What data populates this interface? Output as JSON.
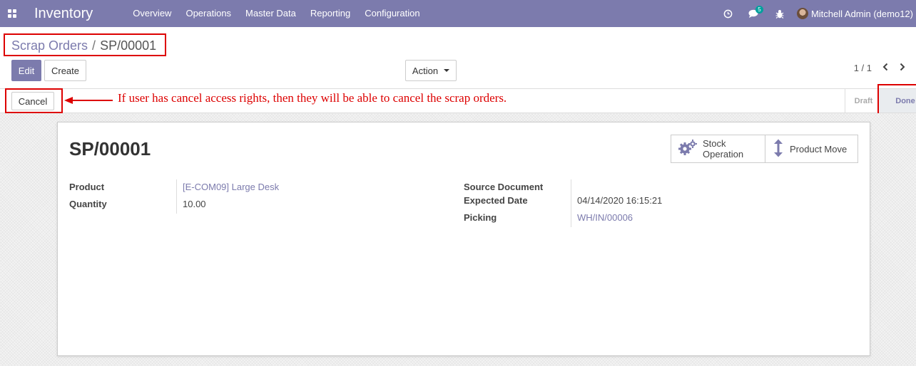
{
  "navbar": {
    "app_title": "Inventory",
    "menu": [
      "Overview",
      "Operations",
      "Master Data",
      "Reporting",
      "Configuration"
    ],
    "messages_badge": "5",
    "user_name": "Mitchell Admin (demo12)"
  },
  "breadcrumb": {
    "parent": "Scrap Orders",
    "separator": "/",
    "current": "SP/00001"
  },
  "toolbar": {
    "edit_label": "Edit",
    "create_label": "Create",
    "action_label": "Action",
    "pager": "1 / 1"
  },
  "statusbar": {
    "cancel_label": "Cancel",
    "annotation": "If user has cancel access rights, then they will be able to cancel the scrap orders.",
    "stages": [
      "Draft",
      "Done"
    ],
    "active_stage": "Done"
  },
  "form": {
    "name": "SP/00001",
    "smart_buttons": {
      "stock_operation_line1": "Stock",
      "stock_operation_line2": "Operation",
      "product_move": "Product Move"
    },
    "left_fields": {
      "product_label": "Product",
      "product_value": "[E-COM09] Large Desk",
      "quantity_label": "Quantity",
      "quantity_value": "10.00"
    },
    "right_fields": {
      "source_document_label": "Source Document",
      "source_document_value": "",
      "expected_date_label": "Expected Date",
      "expected_date_value": "04/14/2020 16:15:21",
      "picking_label": "Picking",
      "picking_value": "WH/IN/00006"
    }
  },
  "colors": {
    "brand": "#7c7bad",
    "annotation_red": "#dd0000",
    "badge": "#00a09d"
  }
}
